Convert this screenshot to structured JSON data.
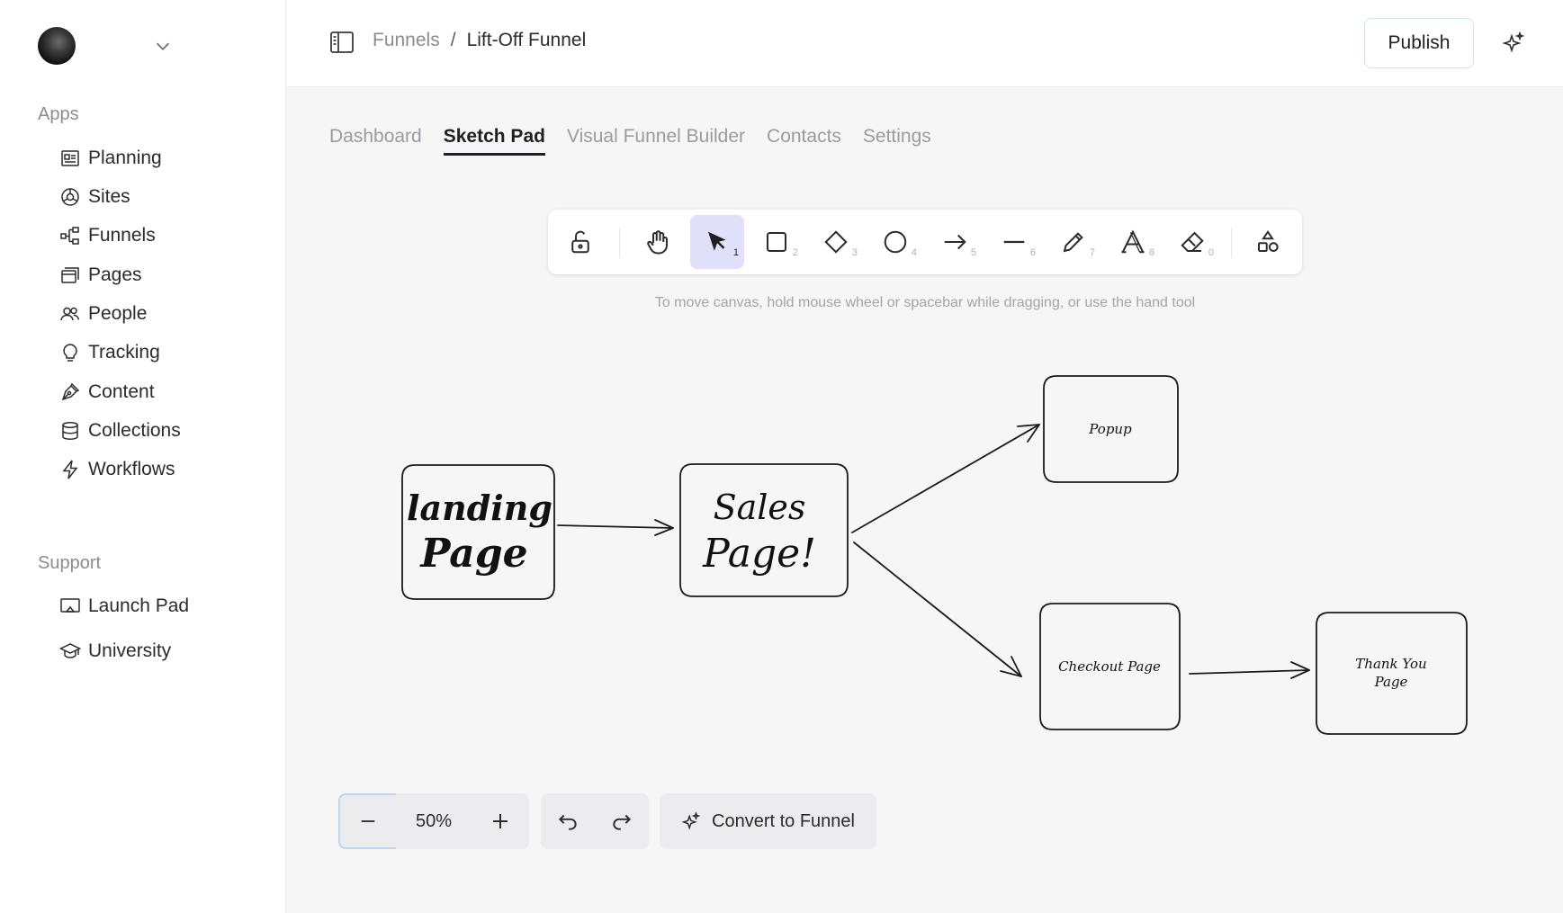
{
  "sidebar": {
    "apps_title": "Apps",
    "support_title": "Support",
    "apps": [
      {
        "label": "Planning",
        "icon": "planning-icon"
      },
      {
        "label": "Sites",
        "icon": "sites-icon"
      },
      {
        "label": "Funnels",
        "icon": "funnels-icon"
      },
      {
        "label": "Pages",
        "icon": "pages-icon"
      },
      {
        "label": "People",
        "icon": "people-icon"
      },
      {
        "label": "Tracking",
        "icon": "tracking-icon"
      },
      {
        "label": "Content",
        "icon": "content-icon"
      },
      {
        "label": "Collections",
        "icon": "collections-icon"
      },
      {
        "label": "Workflows",
        "icon": "workflows-icon"
      }
    ],
    "support": [
      {
        "label": "Launch Pad",
        "icon": "launch-pad-icon"
      },
      {
        "label": "University",
        "icon": "university-icon"
      }
    ]
  },
  "header": {
    "breadcrumb_parent": "Funnels",
    "breadcrumb_sep": "/",
    "breadcrumb_current": "Lift-Off Funnel",
    "publish_label": "Publish"
  },
  "tabs": [
    {
      "label": "Dashboard",
      "active": false
    },
    {
      "label": "Sketch Pad",
      "active": true
    },
    {
      "label": "Visual Funnel Builder",
      "active": false
    },
    {
      "label": "Contacts",
      "active": false
    },
    {
      "label": "Settings",
      "active": false
    }
  ],
  "toolbar": {
    "tools": [
      {
        "name": "lock",
        "key": ""
      },
      {
        "name": "hand",
        "key": ""
      },
      {
        "name": "select",
        "key": "1"
      },
      {
        "name": "rectangle",
        "key": "2"
      },
      {
        "name": "diamond",
        "key": "3"
      },
      {
        "name": "ellipse",
        "key": "4"
      },
      {
        "name": "arrow",
        "key": "5"
      },
      {
        "name": "line",
        "key": "6"
      },
      {
        "name": "draw",
        "key": "7"
      },
      {
        "name": "text",
        "key": "8"
      },
      {
        "name": "eraser",
        "key": "0"
      },
      {
        "name": "shapes",
        "key": ""
      }
    ],
    "active_tool": "select",
    "hint": "To move canvas, hold mouse wheel or spacebar while dragging, or use the hand tool"
  },
  "sketch": {
    "nodes": {
      "landing": [
        "landing",
        "Page"
      ],
      "sales": [
        "Sales",
        "Page!"
      ],
      "popup": "Popup",
      "checkout": "Checkout Page",
      "thankyou": [
        "Thank You",
        "Page"
      ]
    }
  },
  "controls": {
    "zoom": "50%",
    "convert_label": "Convert to Funnel"
  }
}
